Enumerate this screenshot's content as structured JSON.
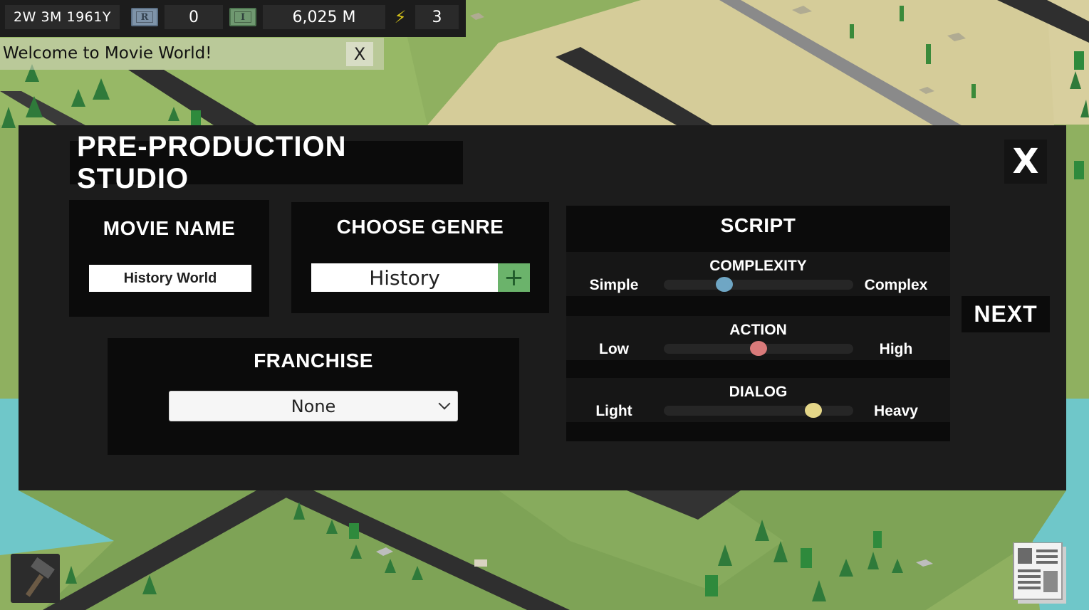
{
  "hud": {
    "date": "2W 3M 1961Y",
    "reputation": "0",
    "money": "6,025 M",
    "energy": "3",
    "reputation_icon_letter": "R",
    "money_icon_letter": "I"
  },
  "notification": {
    "text": "Welcome to Movie World!",
    "close_label": "X"
  },
  "panel": {
    "title": "PRE-PRODUCTION STUDIO",
    "close_label": "X",
    "movie_name": {
      "label": "MOVIE NAME",
      "value": "History World"
    },
    "genre": {
      "label": "CHOOSE GENRE",
      "value": "History",
      "add_label": "+"
    },
    "franchise": {
      "label": "FRANCHISE",
      "selected": "None"
    },
    "script": {
      "label": "SCRIPT",
      "sliders": [
        {
          "label": "COMPLEXITY",
          "low": "Simple",
          "high": "Complex",
          "value": 0.32,
          "color": "#6fa6c4"
        },
        {
          "label": "ACTION",
          "low": "Low",
          "high": "High",
          "value": 0.5,
          "color": "#d97a7a"
        },
        {
          "label": "DIALOG",
          "low": "Light",
          "high": "Heavy",
          "value": 0.79,
          "color": "#e4d688"
        }
      ]
    },
    "next_label": "NEXT"
  },
  "colors": {
    "panel_bg": "#1c1c1c",
    "card_bg": "#0b0b0b",
    "genre_add": "#6bb36b",
    "grass": "#8fb060",
    "water": "#6fc7c9",
    "road": "#2f2f2f",
    "sand": "#d8cf9e"
  },
  "icons": {
    "build": "hammer-icon",
    "news": "newspaper-icon",
    "energy": "lightning-icon"
  }
}
